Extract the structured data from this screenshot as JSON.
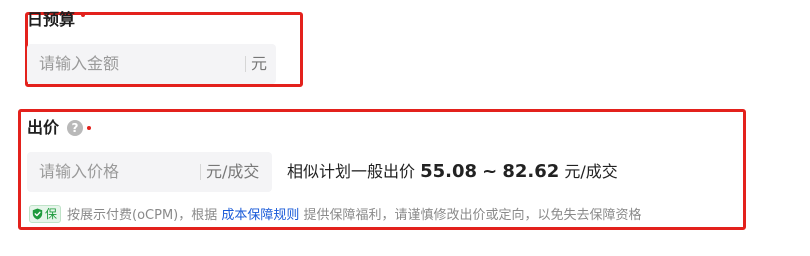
{
  "budget": {
    "label": "日预算",
    "placeholder": "请输入金额",
    "unit": "元"
  },
  "bid": {
    "label": "出价",
    "placeholder": "请输入价格",
    "unit": "元/成交",
    "suggestion_prefix": "相似计划一般出价",
    "suggestion_low": "55.08",
    "suggestion_sep": "~",
    "suggestion_high": "82.62",
    "suggestion_unit": "元/成交"
  },
  "guarantee": {
    "badge": "保",
    "note_prefix": "按展示付费(oCPM)，根据",
    "link": "成本保障规则",
    "note_suffix": "提供保障福利，请谨慎修改出价或定向，以免失去保障资格"
  },
  "colors": {
    "highlight_border": "#e3211c",
    "required_dot": "#e3211c",
    "link": "#1a5bd9",
    "badge": "#1d9a3c"
  }
}
